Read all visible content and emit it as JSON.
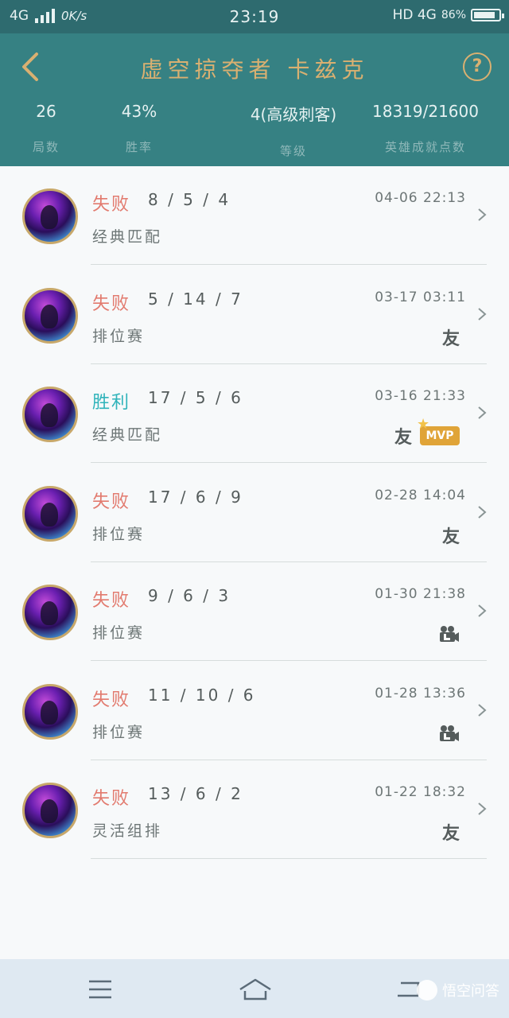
{
  "status_bar": {
    "network": "4G",
    "speed": "0K/s",
    "time": "23:19",
    "hd_network": "HD 4G",
    "battery": "86%",
    "battery_level": 0.86
  },
  "header": {
    "title": "虚空掠夺者 卡兹克",
    "help_label": "?",
    "stats": [
      {
        "value": "26",
        "label": "局数"
      },
      {
        "value": "43%",
        "label": "胜率"
      },
      {
        "value": "4(高级刺客)",
        "label": "等级"
      },
      {
        "value": "18319/21600",
        "label": "英雄成就点数"
      }
    ]
  },
  "matches": [
    {
      "result": "失败",
      "result_type": "loss",
      "kda": "8 / 5 / 4",
      "mode": "经典匹配",
      "time": "04-06 22:13",
      "badges": []
    },
    {
      "result": "失败",
      "result_type": "loss",
      "kda": "5 / 14 / 7",
      "mode": "排位赛",
      "time": "03-17 03:11",
      "badges": [
        "友"
      ]
    },
    {
      "result": "胜利",
      "result_type": "win",
      "kda": "17 / 5 / 6",
      "mode": "经典匹配",
      "time": "03-16 21:33",
      "badges": [
        "友",
        "MVP"
      ]
    },
    {
      "result": "失败",
      "result_type": "loss",
      "kda": "17 / 6 / 9",
      "mode": "排位赛",
      "time": "02-28 14:04",
      "badges": [
        "友"
      ]
    },
    {
      "result": "失败",
      "result_type": "loss",
      "kda": "9 / 6 / 3",
      "mode": "排位赛",
      "time": "01-30 21:38",
      "badges": [
        "video-icon"
      ]
    },
    {
      "result": "失败",
      "result_type": "loss",
      "kda": "11 / 10 / 6",
      "mode": "排位赛",
      "time": "01-28 13:36",
      "badges": [
        "video-icon"
      ]
    },
    {
      "result": "失败",
      "result_type": "loss",
      "kda": "13 / 6 / 2",
      "mode": "灵活组排",
      "time": "01-22 18:32",
      "badges": [
        "友"
      ]
    }
  ],
  "colors": {
    "header_bg": "#368183",
    "title_gold": "#d9b071",
    "loss": "#e27a6e",
    "win": "#2fb3ba",
    "mvp": "#e0a438"
  },
  "watermark": "悟空问答"
}
